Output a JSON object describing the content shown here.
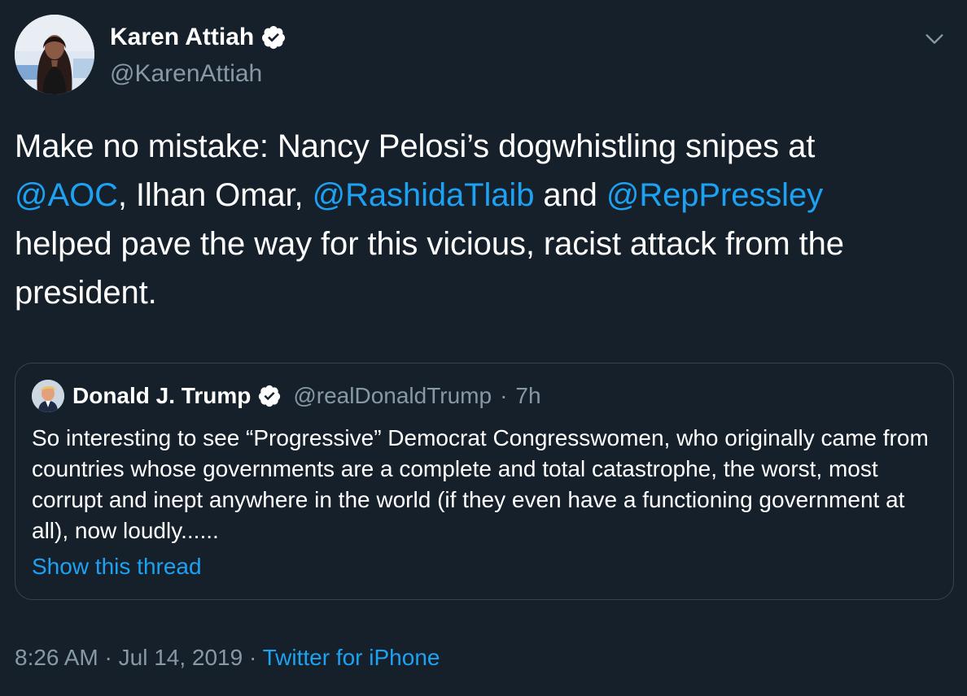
{
  "colors": {
    "background": "#15202b",
    "primary_text": "#ffffff",
    "secondary_text": "#8899a6",
    "link": "#1da1f2",
    "border": "#38444d"
  },
  "author": {
    "name": "Karen Attiah",
    "handle": "@KarenAttiah",
    "verified_icon": "verified-badge-icon",
    "avatar": "profile-photo"
  },
  "tweet": {
    "text_part_1": "Make no mistake:  Nancy Pelosi’s dogwhistling snipes at",
    "mention_1": "@AOC",
    "text_part_2": ", Ilhan Omar, ",
    "mention_2": "@RashidaTlaib",
    "text_part_3": " and ",
    "mention_3": "@RepPressley",
    "text_part_4": "helped pave the way for this vicious, racist attack from the president."
  },
  "quote": {
    "name": "Donald J. Trump",
    "handle": "@realDonaldTrump",
    "separator": "·",
    "time": "7h",
    "text": "So interesting to see “Progressive” Democrat Congresswomen, who originally came from countries whose governments are a complete and total catastrophe, the worst, most corrupt and inept anywhere in the world (if they even have a functioning government at all), now loudly......",
    "show_thread_label": "Show this thread"
  },
  "footer": {
    "time": "8:26 AM",
    "separator": "·",
    "date": "Jul 14, 2019",
    "source": "Twitter for iPhone"
  }
}
